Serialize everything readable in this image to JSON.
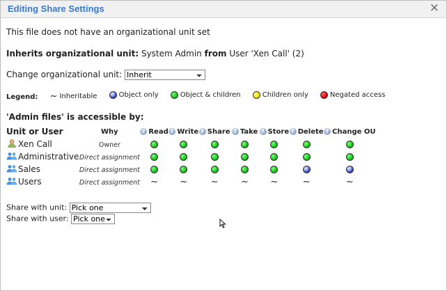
{
  "dialog": {
    "title": "Editing Share Settings",
    "close_icon": "close-icon"
  },
  "info": {
    "no_ou": "This file does not have an organizational unit set",
    "inherits_label": "Inherits organizational unit:",
    "inherits_value": "System Admin",
    "from_label": "from",
    "from_value": "User 'Xen Call' (2)",
    "change_label": "Change organizational unit:",
    "change_value": "Inherit"
  },
  "legend": {
    "label": "Legend:",
    "items": [
      {
        "icon": "tilde",
        "text": "Inheritable"
      },
      {
        "icon": "blue-dot",
        "text": "Object only"
      },
      {
        "icon": "green-dot",
        "text": "Object & children"
      },
      {
        "icon": "yellow-dot",
        "text": "Children only"
      },
      {
        "icon": "red-dot",
        "text": "Negated access"
      }
    ]
  },
  "colors": {
    "accent": "#3a78c8",
    "green": "#18c418",
    "blue": "#3d4fc2",
    "yellow": "#f0e000",
    "red": "#e00000"
  },
  "access": {
    "heading": "'Admin files' is accessible by:",
    "columns": {
      "unit": "Unit or User",
      "why": "Why",
      "perms": [
        "Read",
        "Write",
        "Share",
        "Take",
        "Store",
        "Delete",
        "Change OU"
      ]
    },
    "rows": [
      {
        "name": "Xen Call",
        "icon": "user-icon",
        "why": "Owner",
        "perms": [
          "green",
          "green",
          "green",
          "green",
          "green",
          "green",
          "green"
        ]
      },
      {
        "name": "Administrative",
        "icon": "group-icon",
        "why": "Direct assignment",
        "perms": [
          "green",
          "green",
          "green",
          "green",
          "green",
          "green",
          "green"
        ]
      },
      {
        "name": "Sales",
        "icon": "group-icon",
        "why": "Direct assignment",
        "perms": [
          "green",
          "green",
          "green",
          "green",
          "green",
          "blue",
          "blue"
        ]
      },
      {
        "name": "Users",
        "icon": "group-icon",
        "why": "Direct assignment",
        "perms": [
          "tilde",
          "tilde",
          "tilde",
          "tilde",
          "tilde",
          "tilde",
          "tilde"
        ]
      }
    ]
  },
  "share": {
    "unit_label": "Share with unit:",
    "unit_value": "Pick one",
    "user_label": "Share with user:",
    "user_value": "Pick one"
  }
}
